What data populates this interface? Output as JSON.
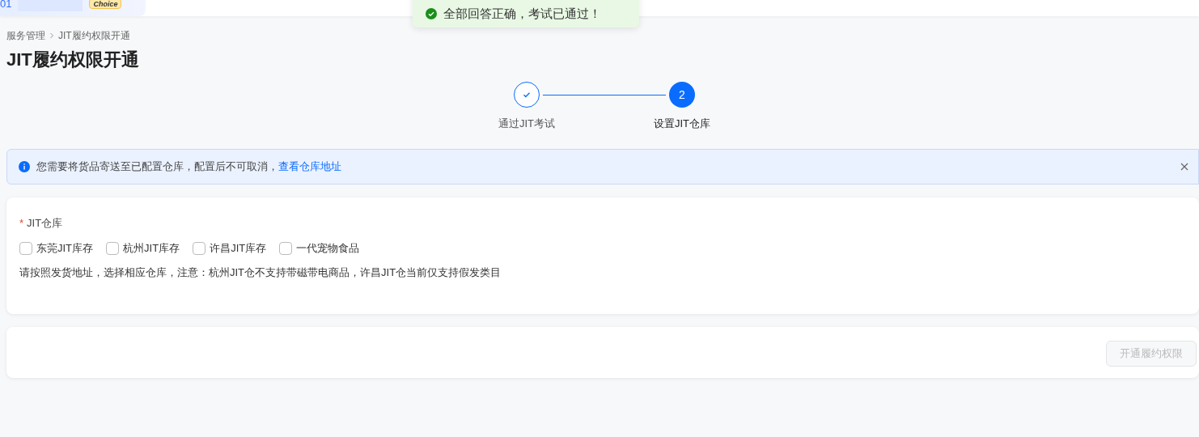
{
  "header": {
    "account_text": "01",
    "badge": "Choice"
  },
  "toast": {
    "kind": "success",
    "message": "全部回答正确，考试已通过！"
  },
  "breadcrumb": [
    "服务管理",
    "JIT履约权限开通"
  ],
  "page_title": "JIT履约权限开通",
  "steps": [
    {
      "label": "通过JIT考试",
      "completed": true
    },
    {
      "label": "设置JIT仓库",
      "number": "2",
      "completed": false
    }
  ],
  "alert": {
    "message": "您需要将货品寄送至已配置仓库，配置后不可取消，",
    "link": "查看仓库地址"
  },
  "form": {
    "label": "JIT仓库",
    "required_mark": "*",
    "options": [
      {
        "label": "东莞JIT库存",
        "checked": false
      },
      {
        "label": "杭州JIT库存",
        "checked": false
      },
      {
        "label": "许昌JIT库存",
        "checked": false
      },
      {
        "label": "一代宠物食品",
        "checked": false
      }
    ],
    "hint": "请按照发货地址，选择相应仓库，注意：杭州JIT仓不支持带磁带电商品，许昌JIT仓当前仅支持假发类目"
  },
  "footer": {
    "submit": {
      "label": "开通履约权限",
      "disabled": true
    }
  }
}
